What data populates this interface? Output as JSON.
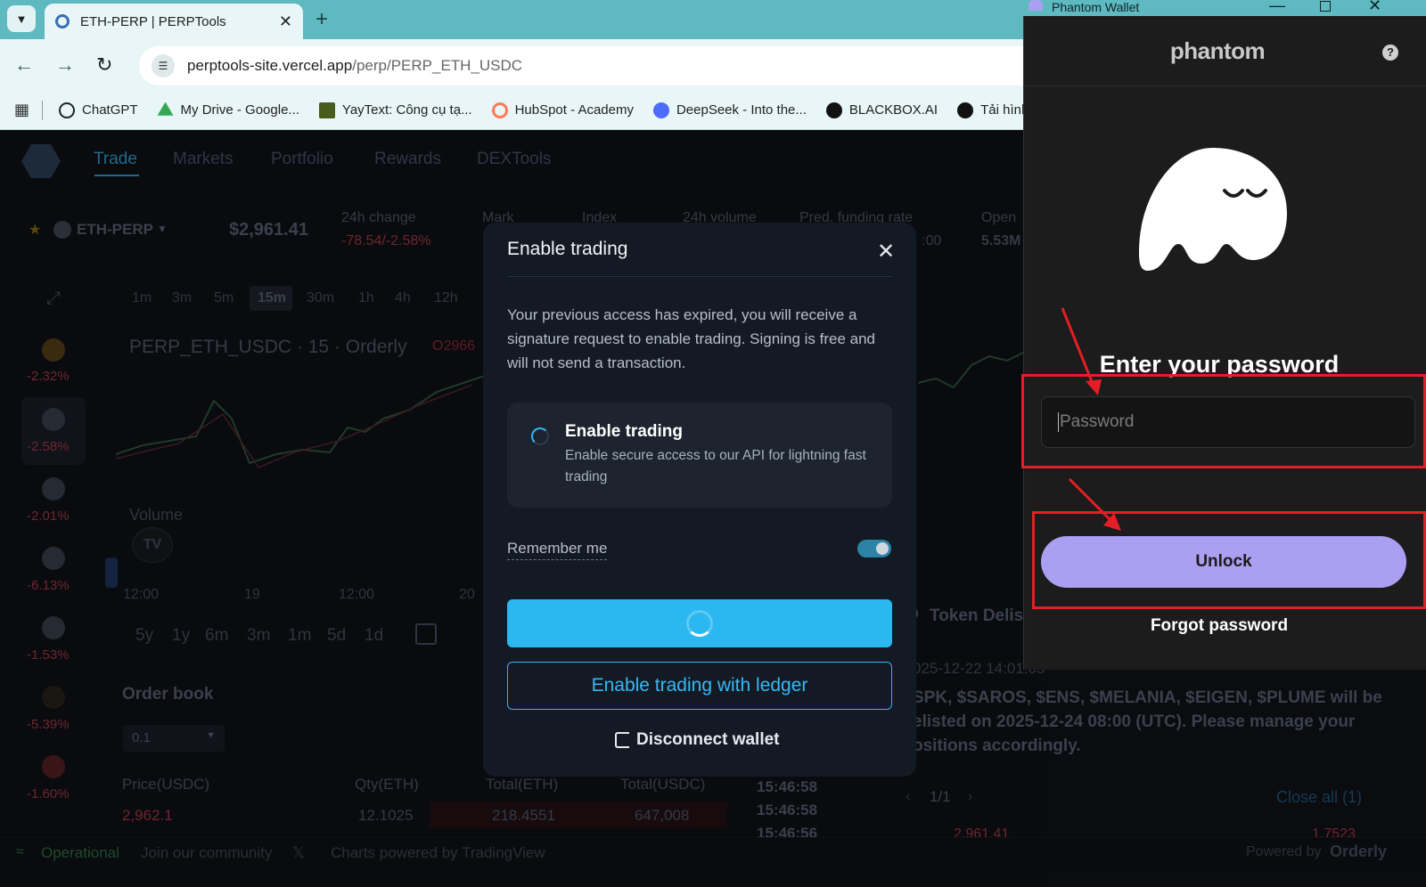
{
  "browser": {
    "tab_title": "ETH-PERP | PERPTools",
    "url_host": "perptools-site.vercel.app",
    "url_path": "/perp/PERP_ETH_USDC",
    "bookmarks": [
      {
        "label": "ChatGPT",
        "color": "#222222"
      },
      {
        "label": "My Drive - Google...",
        "color": "#34a853"
      },
      {
        "label": "YayText: Công cụ tạ...",
        "color": "#6b8e23"
      },
      {
        "label": "HubSpot - Academy",
        "color": "#ff7a59"
      },
      {
        "label": "DeepSeek - Into the...",
        "color": "#4d6bfe"
      },
      {
        "label": "BLACKBOX.AI",
        "color": "#111111"
      },
      {
        "label": "Tải hình ản",
        "color": "#111111"
      }
    ]
  },
  "app": {
    "nav": [
      "Trade",
      "Markets",
      "Portfolio",
      "Rewards",
      "DEXTools"
    ],
    "symbol": "ETH-PERP",
    "price": "$2,961.41",
    "change_label": "24h change",
    "change_value": "-78.54/-2.58%",
    "mark_label": "Mark",
    "index_label": "Index",
    "volume_label": "24h volume",
    "funding_label": "Pred. funding rate",
    "funding_value": ":00",
    "open_label": "Open",
    "open_value": "5.53M",
    "side_pcts": [
      "-2.32%",
      "-2.58%",
      "-2.01%",
      "-6.13%",
      "-1.53%",
      "-5.39%",
      "-1.60%"
    ],
    "timeframes": [
      "1m",
      "3m",
      "5m",
      "15m",
      "30m",
      "1h",
      "4h",
      "12h"
    ],
    "chart_title": "PERP_ETH_USDC · 15 · Orderly",
    "chart_price_snippet": "O2966",
    "volume_label_chart": "Volume",
    "axis_labels": [
      "12:00",
      "19",
      "12:00",
      "20"
    ],
    "ranges": [
      "5y",
      "1y",
      "6m",
      "3m",
      "1m",
      "5d",
      "1d"
    ],
    "orderbook_title": "Order book",
    "orderbook_step": "0.1",
    "ob_headers": [
      "Price(USDC)",
      "Qty(ETH)",
      "Total(ETH)",
      "Total(USDC)"
    ],
    "ob_row": [
      "2,962.1",
      "12.1025",
      "218.4551",
      "647,008"
    ],
    "trade_times": [
      "15:46:58",
      "15:46:58",
      "15:46:56"
    ],
    "news_title": "Token Delis",
    "news_time": "025-12-22 14:01:05",
    "news_lines": [
      "SPK, $SAROS, $ENS, $MELANIA, $EIGEN, $PLUME will be",
      "elisted on 2025-12-24 08:00 (UTC). Please manage your",
      "ositions accordingly."
    ],
    "pagination": "1/1",
    "close_all": "Close all (1)",
    "pos_price": "2,961.41",
    "pos_qty": "1.7523",
    "status": "Operational",
    "community": "Join our community",
    "charts_powered": "Charts powered by TradingView",
    "powered_by": "Powered by",
    "orderly": "Orderly"
  },
  "modal": {
    "title": "Enable trading",
    "description": "Your previous access has expired, you will receive a signature request to enable trading. Signing is free and will not send a transaction.",
    "card_title": "Enable trading",
    "card_subtitle": "Enable secure access to our API for lightning fast trading",
    "remember_label": "Remember me",
    "remember_on": true,
    "ledger_button": "Enable trading with ledger",
    "disconnect_button": "Disconnect wallet"
  },
  "phantom": {
    "window_title": "Phantom Wallet",
    "brand": "phantom",
    "heading": "Enter your password",
    "password_placeholder": "Password",
    "unlock_button": "Unlock",
    "forgot_link": "Forgot password",
    "accent_color": "#ab9ff2"
  },
  "annotation_color": "#e41e26"
}
